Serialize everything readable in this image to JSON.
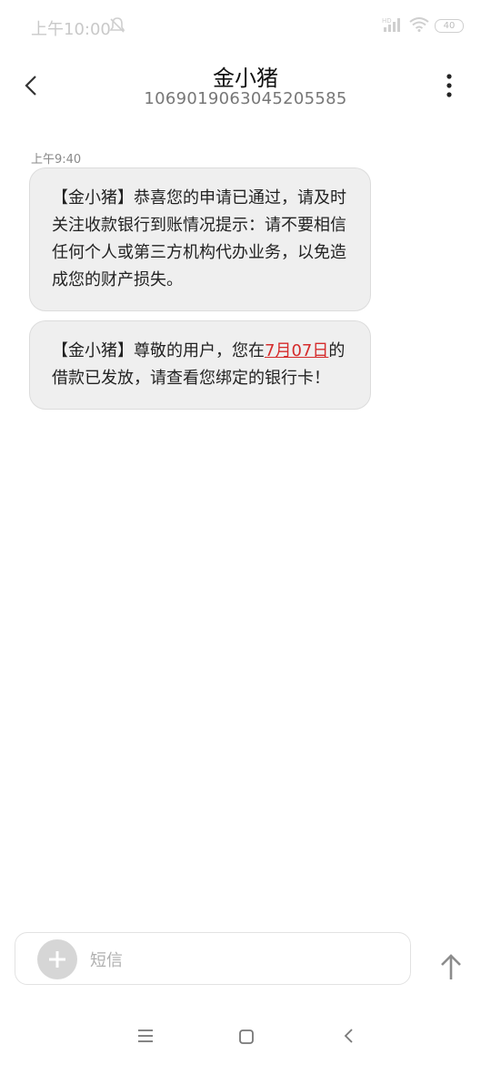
{
  "status_bar": {
    "time": "上午10:00",
    "battery": "40"
  },
  "header": {
    "title": "金小猪",
    "number": "1069019063045205585"
  },
  "messages": {
    "timestamp": "上午9:40",
    "items": [
      {
        "text": "【金小猪】恭喜您的申请已通过，请及时关注收款银行到账情况提示：请不要相信任何个人或第三方机构代办业务，以免造成您的财产损失。"
      },
      {
        "prefix": "【金小猪】尊敬的用户，您在",
        "date": "7月07日",
        "suffix": "的借款已发放，请查看您绑定的银行卡！"
      }
    ]
  },
  "input": {
    "placeholder": "短信"
  },
  "colors": {
    "bubble_bg": "#efefef",
    "link_red": "#d52b2b",
    "status_text": "#c9c9c9"
  },
  "icons": [
    "bell-off-icon",
    "signal-icon",
    "wifi-icon",
    "battery-icon",
    "back-arrow-icon",
    "more-vertical-icon",
    "plus-icon",
    "send-arrow-icon",
    "menu-icon",
    "home-icon",
    "nav-back-icon"
  ]
}
